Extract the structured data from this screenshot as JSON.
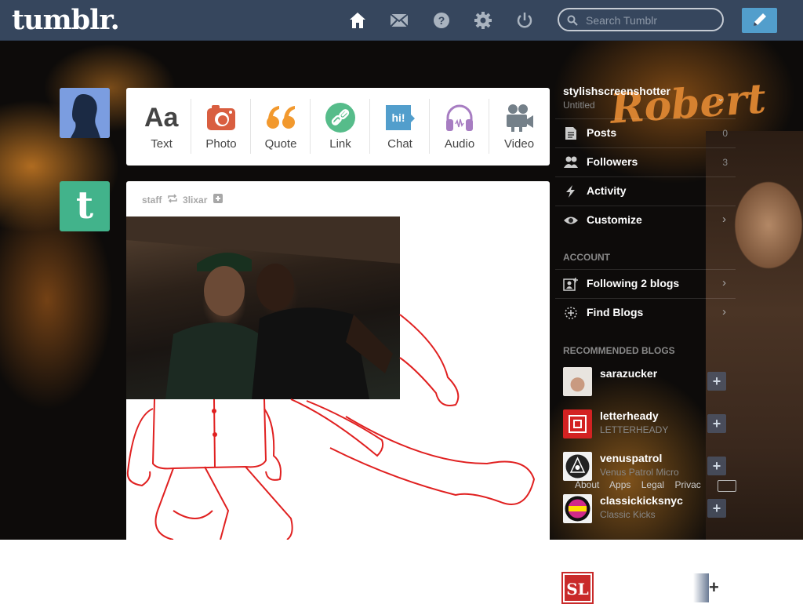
{
  "header": {
    "logo": "tumblr.",
    "nav_icons": [
      "home-icon",
      "mail-icon",
      "help-icon",
      "gear-icon",
      "power-icon"
    ],
    "search_placeholder": "Search Tumblr",
    "compose_icon": "pencil-icon"
  },
  "background": {
    "text": "Robert"
  },
  "left": {
    "tumblr_avatar_glyph": "t"
  },
  "post_types": [
    {
      "label": "Text",
      "icon": "text-icon",
      "color": "#444444",
      "glyph": "Aa"
    },
    {
      "label": "Photo",
      "icon": "camera-icon",
      "color": "#d95e40"
    },
    {
      "label": "Quote",
      "icon": "quote-icon",
      "color": "#f2992e",
      "glyph": "“"
    },
    {
      "label": "Link",
      "icon": "link-icon",
      "color": "#56bc8a"
    },
    {
      "label": "Chat",
      "icon": "chat-icon",
      "color": "#529ecc",
      "glyph": "hi!"
    },
    {
      "label": "Audio",
      "icon": "headphones-icon",
      "color": "#a77dc2"
    },
    {
      "label": "Video",
      "icon": "video-camera-icon",
      "color": "#748089"
    }
  ],
  "post": {
    "author": "staff",
    "reblogged_from": "3lixar"
  },
  "sidebar": {
    "blog_name": "stylishscreenshotter",
    "blog_title": "Untitled",
    "items": [
      {
        "label": "Posts",
        "count": "0",
        "icon": "posts-icon"
      },
      {
        "label": "Followers",
        "count": "3",
        "icon": "followers-icon"
      },
      {
        "label": "Activity",
        "count": "",
        "icon": "lightning-icon"
      },
      {
        "label": "Customize",
        "count": "",
        "icon": "eye-icon"
      }
    ],
    "account_heading": "ACCOUNT",
    "account_items": [
      {
        "label": "Following 2 blogs",
        "icon": "following-icon"
      },
      {
        "label": "Find Blogs",
        "icon": "find-blogs-icon"
      }
    ],
    "recommended_heading": "RECOMMENDED BLOGS",
    "recommended": [
      {
        "name": "sarazucker",
        "title": ""
      },
      {
        "name": "letterheady",
        "title": "LETTERHEADY"
      },
      {
        "name": "venuspatrol",
        "title": "Venus Patrol Micro"
      },
      {
        "name": "classickicksnyc",
        "title": "Classic Kicks"
      }
    ],
    "footer_links": [
      "About",
      "Apps",
      "Legal",
      "Privac"
    ],
    "sl_badge": "SL"
  }
}
